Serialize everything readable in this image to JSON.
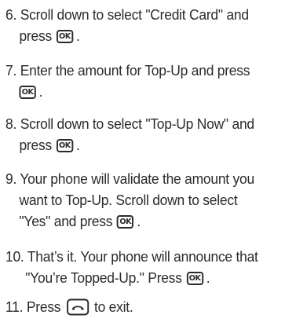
{
  "steps": [
    {
      "number": "6.",
      "line1": "Scroll down to select \"Credit Card\" and",
      "line2_pre": "press",
      "key": "OK",
      "line2_post": "."
    },
    {
      "number": "7.",
      "line1": "Enter the amount for Top-Up and press",
      "line2_pre": "",
      "key": "OK",
      "line2_post": "."
    },
    {
      "number": "8.",
      "line1": "Scroll down to select \"Top-Up Now\" and",
      "line2_pre": "press",
      "key": "OK",
      "line2_post": "."
    },
    {
      "number": "9.",
      "line1": "Your phone will validate the amount you",
      "line2": "want to Top-Up. Scroll down to select",
      "line3_pre": "\"Yes\" and press",
      "key": "OK",
      "line3_post": "."
    },
    {
      "number": "10.",
      "line1": "That’s it. Your phone will announce that",
      "line2_pre": "\"You’re Topped-Up.\" Press",
      "key": "OK",
      "line2_post": "."
    },
    {
      "number": "11.",
      "text_pre": "Press",
      "key_icon": "end-call-key-icon",
      "text_post": "to exit."
    }
  ]
}
